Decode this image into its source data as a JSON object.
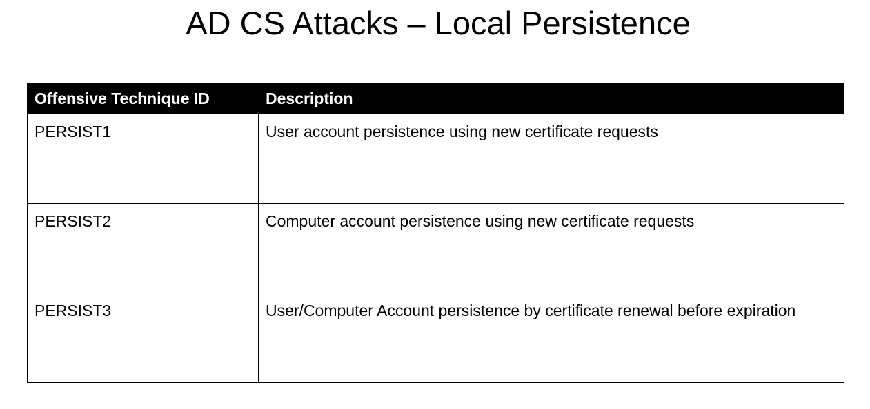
{
  "slide": {
    "title": "AD CS Attacks – Local Persistence"
  },
  "table": {
    "headers": {
      "id": "Offensive Technique ID",
      "description": "Description"
    },
    "rows": [
      {
        "id": "PERSIST1",
        "description": "User account persistence using new certificate requests"
      },
      {
        "id": "PERSIST2",
        "description": "Computer account persistence using new certificate requests"
      },
      {
        "id": "PERSIST3",
        "description": "User/Computer Account persistence by certificate renewal before expiration"
      }
    ]
  }
}
